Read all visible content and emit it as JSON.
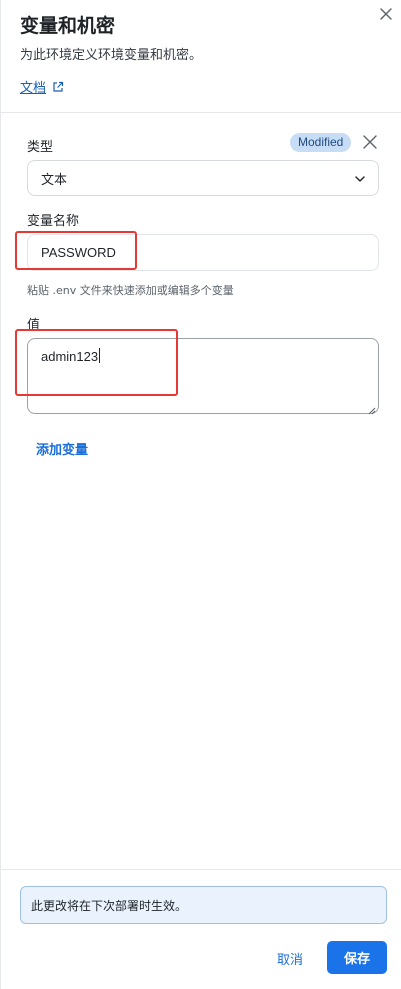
{
  "panel": {
    "title": "变量和机密",
    "subtitle": "为此环境定义环境变量和机密。",
    "docs_link": "文档"
  },
  "form": {
    "type_label": "类型",
    "modified_badge": "Modified",
    "type_value": "文本",
    "name_label": "变量名称",
    "name_value": "PASSWORD",
    "paste_hint": "粘贴 .env 文件来快速添加或编辑多个变量",
    "value_label": "值",
    "value_text": "admin123",
    "add_variable": "添加变量"
  },
  "footer": {
    "notice": "此更改将在下次部署时生效。",
    "cancel_label": "取消",
    "save_label": "保存"
  },
  "colors": {
    "accent": "#1a73e8",
    "highlight_box": "#e53935",
    "badge_bg": "#c7dcf5",
    "notice_bg": "#eaf3fd"
  }
}
